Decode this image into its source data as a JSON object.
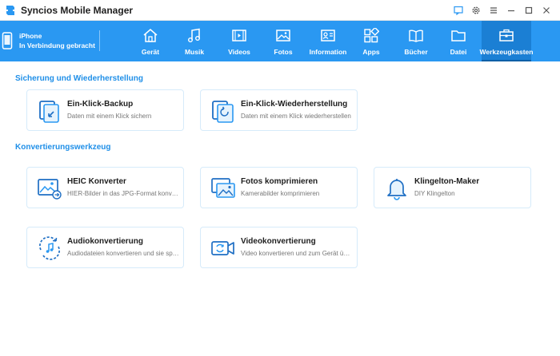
{
  "app": {
    "title": "Syncios Mobile Manager"
  },
  "device": {
    "name": "iPhone",
    "status": "In Verbindung gebracht"
  },
  "tabs": [
    {
      "label": "Gerät",
      "icon": "home-icon"
    },
    {
      "label": "Musik",
      "icon": "music-icon"
    },
    {
      "label": "Videos",
      "icon": "video-icon"
    },
    {
      "label": "Fotos",
      "icon": "photo-icon"
    },
    {
      "label": "Information",
      "icon": "contact-card-icon"
    },
    {
      "label": "Apps",
      "icon": "apps-icon"
    },
    {
      "label": "Bücher",
      "icon": "book-icon"
    },
    {
      "label": "Datei",
      "icon": "folder-icon"
    },
    {
      "label": "Werkzeugkasten",
      "icon": "toolbox-icon",
      "active": true
    }
  ],
  "sections": {
    "backup": {
      "title": "Sicherung und Wiederherstellung",
      "cards": [
        {
          "title": "Ein-Klick-Backup",
          "desc": "Daten mit einem Klick sichern",
          "icon": "backup-icon"
        },
        {
          "title": "Ein-Klick-Wiederherstellung",
          "desc": "Daten mit einem Klick wiederherstellen",
          "icon": "restore-icon"
        }
      ]
    },
    "convert": {
      "title": "Konvertierungswerkzeug",
      "cards": [
        {
          "title": "HEIC Konverter",
          "desc": "HIER-Bilder in das JPG-Format konvertieren",
          "icon": "heic-icon"
        },
        {
          "title": "Fotos komprimieren",
          "desc": "Kamerabilder komprimieren",
          "icon": "compress-photo-icon"
        },
        {
          "title": "Klingelton-Maker",
          "desc": "DIY Klingelton",
          "icon": "bell-icon"
        },
        {
          "title": "Audiokonvertierung",
          "desc": "Audiodateien konvertieren und sie speichern",
          "icon": "audio-convert-icon"
        },
        {
          "title": "Videokonvertierung",
          "desc": "Video konvertieren und zum Gerät übertragen",
          "icon": "video-convert-icon"
        }
      ]
    }
  },
  "colors": {
    "accent": "#2a98f2",
    "active_tab": "#1b7fd4",
    "section_title": "#1f8fe8"
  }
}
